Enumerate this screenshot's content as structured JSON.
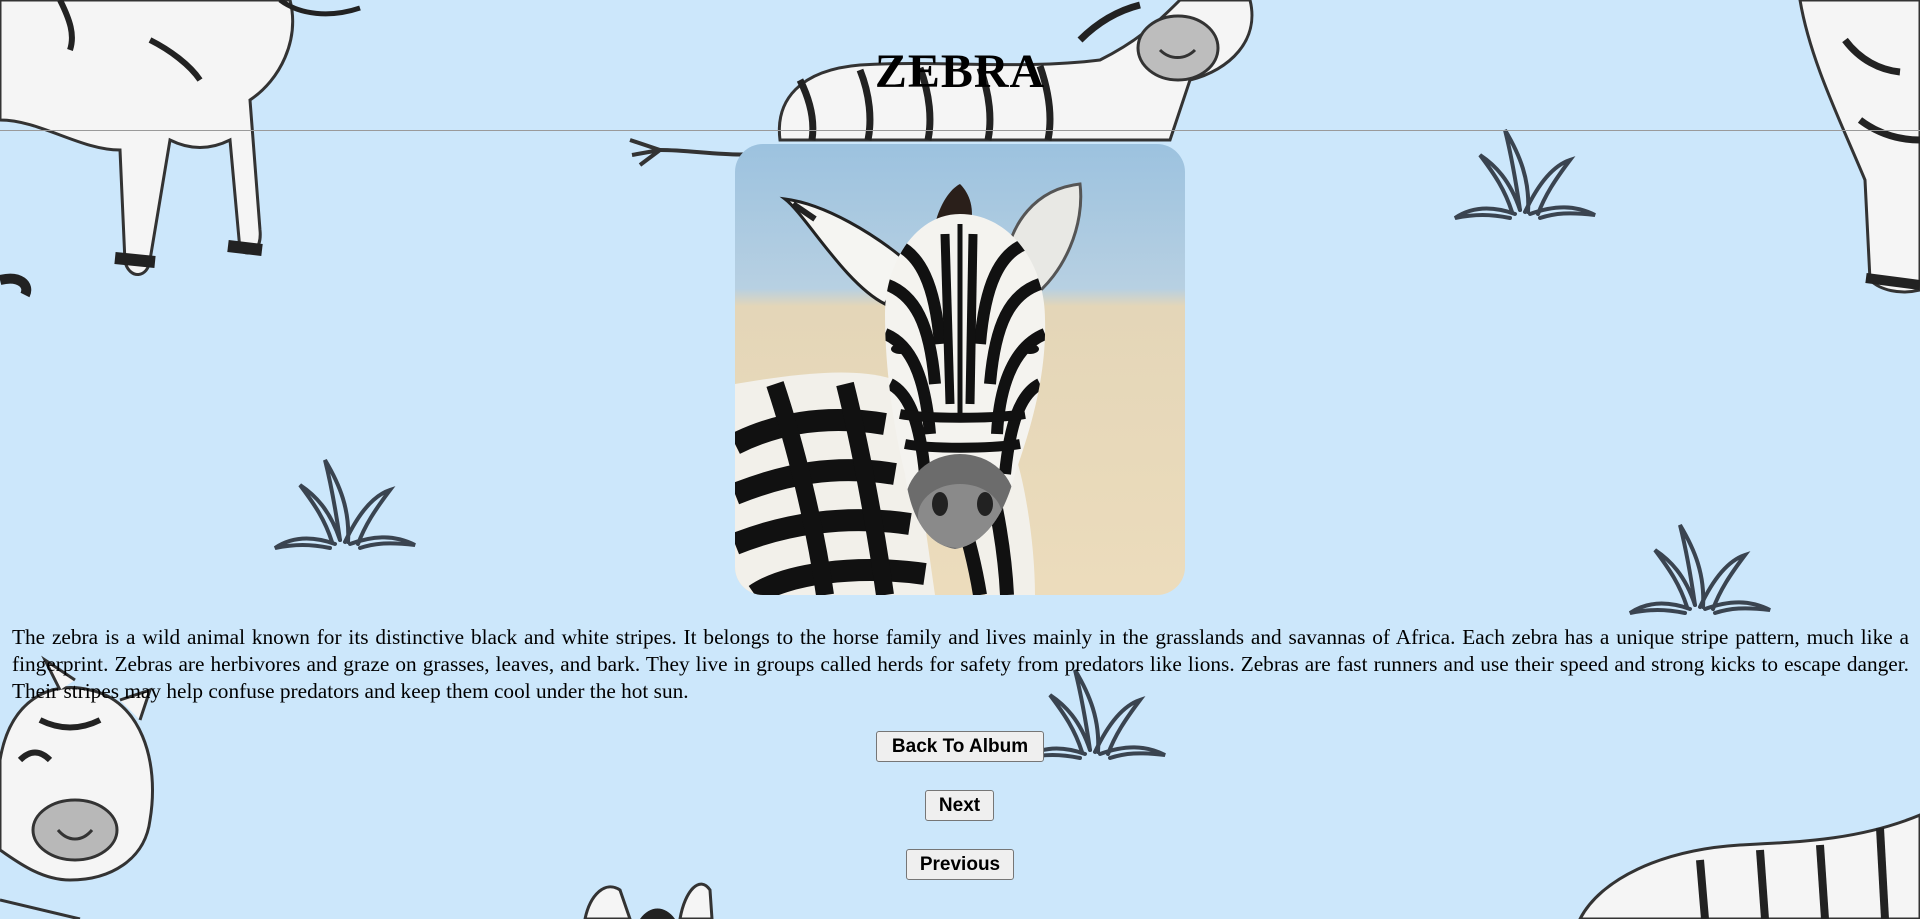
{
  "page": {
    "title": "ZEBRA",
    "description": "The zebra is a wild animal known for its distinctive black and white stripes. It belongs to the horse family and lives mainly in the grasslands and savannas of Africa. Each zebra has a unique stripe pattern, much like a fingerprint. Zebras are herbivores and graze on grasses, leaves, and bark. They live in groups called herds for safety from predators like lions. Zebras are fast runners and use their speed and strong kicks to escape danger. Their stripes may help confuse predators and keep them cool under the hot sun."
  },
  "buttons": {
    "back_label": "Back To Album",
    "next_label": "Next",
    "previous_label": "Previous"
  },
  "colors": {
    "background": "#cce7fb",
    "button_bg": "#efefef"
  }
}
